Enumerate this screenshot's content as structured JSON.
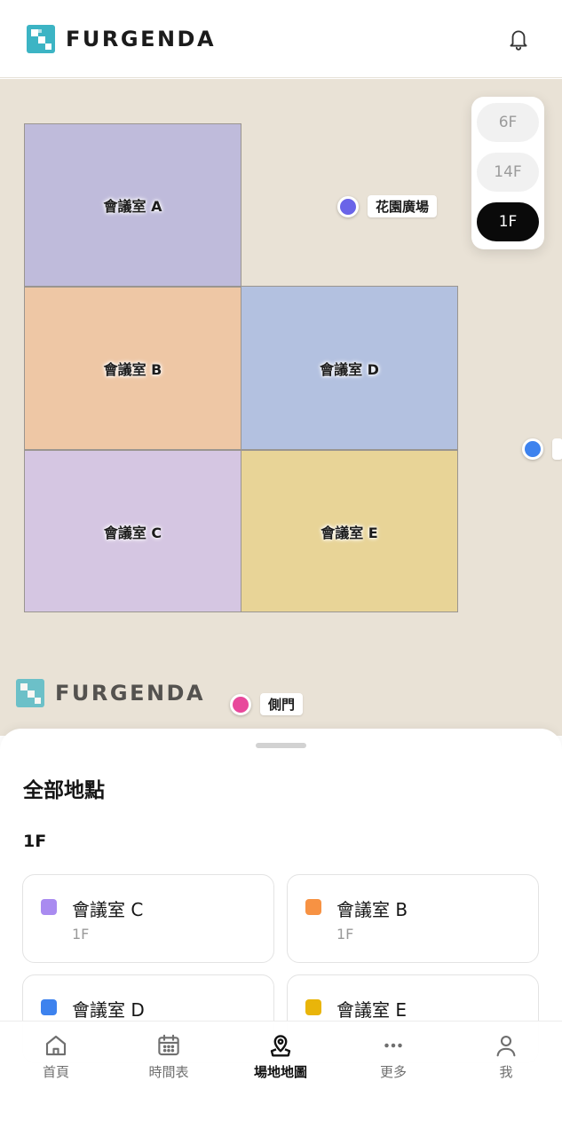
{
  "header": {
    "brand": "FURGENDA",
    "notification_icon": "bell-icon"
  },
  "colors": {
    "accent": "#3cb4c4",
    "active_tab": "#111111"
  },
  "map": {
    "rooms": [
      {
        "id": "a",
        "label": "會議室 A",
        "color": "#bfbbdb"
      },
      {
        "id": "b",
        "label": "會議室 B",
        "color": "#eec7a5"
      },
      {
        "id": "c",
        "label": "會議室 C",
        "color": "#d5c6e2"
      },
      {
        "id": "d",
        "label": "會議室 D",
        "color": "#b3c1e0"
      },
      {
        "id": "e",
        "label": "會議室 E",
        "color": "#e8d497"
      }
    ],
    "pois": [
      {
        "id": "garden",
        "label": "花園廣場",
        "color": "#6a64e8"
      },
      {
        "id": "side_gate",
        "label": "側門",
        "color": "#e8489b"
      },
      {
        "id": "right_edge",
        "label": "",
        "color": "#3d82ee"
      }
    ],
    "watermark_brand": "FURGENDA"
  },
  "floor_selector": {
    "options": [
      "6F",
      "14F",
      "1F"
    ],
    "selected": "1F"
  },
  "sheet": {
    "title": "全部地點",
    "floor_heading": "1F",
    "locations": [
      {
        "name": "會議室 C",
        "floor": "1F",
        "color": "#a98bf0"
      },
      {
        "name": "會議室 B",
        "floor": "1F",
        "color": "#f79243"
      },
      {
        "name": "會議室 D",
        "floor": "",
        "color": "#3d82ee"
      },
      {
        "name": "會議室 E",
        "floor": "",
        "color": "#e9b50a"
      }
    ]
  },
  "tabs": [
    {
      "label": "首頁",
      "icon": "home-icon",
      "active": false
    },
    {
      "label": "時間表",
      "icon": "calendar-icon",
      "active": false
    },
    {
      "label": "場地地圖",
      "icon": "map-pin-icon",
      "active": true
    },
    {
      "label": "更多",
      "icon": "more-icon",
      "active": false
    },
    {
      "label": "我",
      "icon": "profile-icon",
      "active": false
    }
  ]
}
